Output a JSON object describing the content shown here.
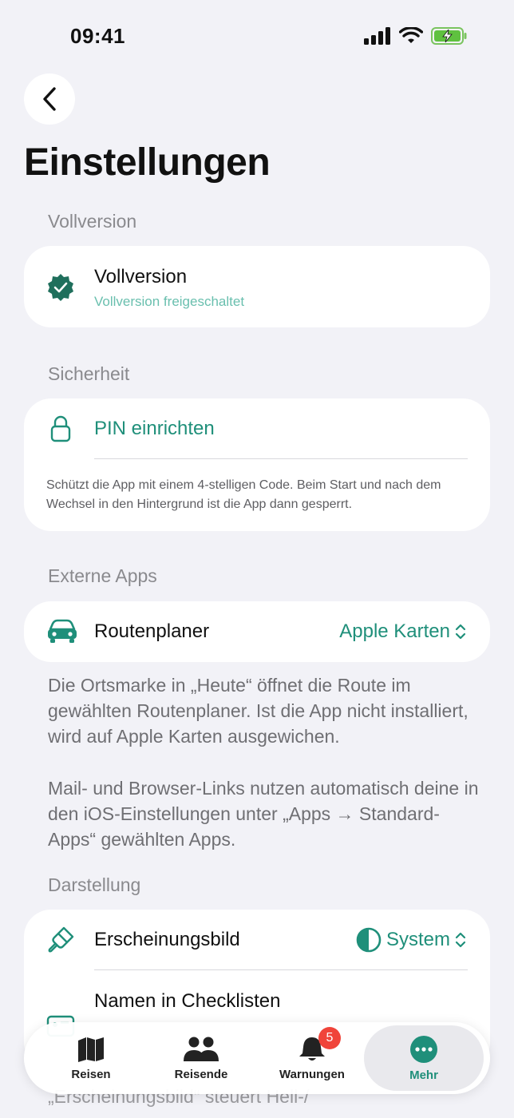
{
  "status_bar": {
    "time": "09:41"
  },
  "page": {
    "title": "Einstellungen"
  },
  "sections": {
    "vollversion": {
      "header": "Vollversion",
      "title": "Vollversion",
      "subtitle": "Vollversion freigeschaltet"
    },
    "sicherheit": {
      "header": "Sicherheit",
      "pin_label": "PIN einrichten",
      "description": "Schützt die App mit einem 4-stelligen Code. Beim Start und nach dem Wechsel in den Hintergrund ist die App dann gesperrt."
    },
    "externe_apps": {
      "header": "Externe Apps",
      "route_label": "Routenplaner",
      "route_value": "Apple Karten",
      "footer1": "Die Ortsmarke in „Heute“ öffnet die Route im gewählten Routenplaner. Ist die App nicht installiert, wird auf Apple Karten ausgewichen.",
      "footer2": "Mail- und Browser-Links nutzen automatisch deine in den iOS-Einstellungen unter „Apps → Standard-Apps“ gewählten Apps."
    },
    "darstellung": {
      "header": "Darstellung",
      "appearance_label": "Erscheinungsbild",
      "appearance_value": "System",
      "names_label": "Namen in Checklisten",
      "bottom_text": "„Erscheinungsbild“ steuert Hell-/"
    }
  },
  "tabbar": {
    "tabs": [
      {
        "label": "Reisen",
        "icon": "map-icon"
      },
      {
        "label": "Reisende",
        "icon": "people-icon"
      },
      {
        "label": "Warnungen",
        "icon": "bell-icon",
        "badge": "5"
      },
      {
        "label": "Mehr",
        "icon": "more-icon"
      }
    ]
  },
  "colors": {
    "accent": "#1f8f7a",
    "badge": "#f0443a",
    "background": "#f2f2f7"
  }
}
